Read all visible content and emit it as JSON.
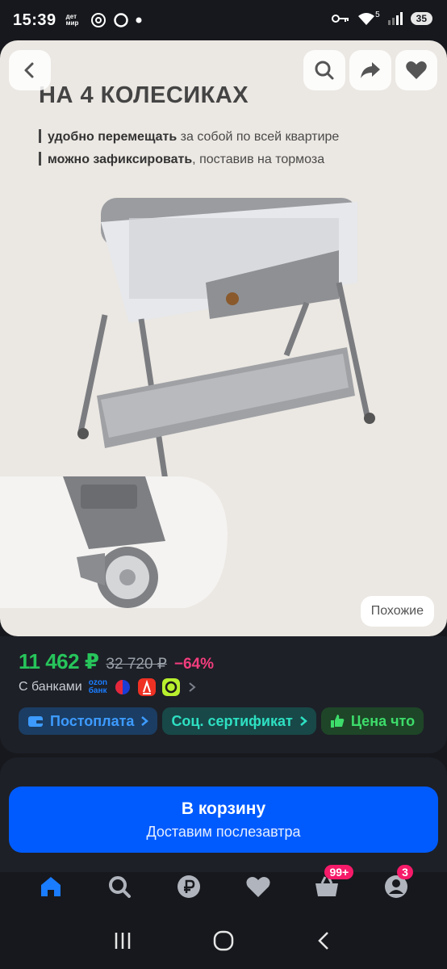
{
  "status_bar": {
    "time": "15:39",
    "brand_mini": "дет мир",
    "network_badge": "5",
    "battery": "35"
  },
  "gallery": {
    "heading": "НА 4 КОЛЕСИКАХ",
    "line1_bold": "удобно перемещать",
    "line1_rest": " за собой по всей квартире",
    "line2_bold": "можно зафиксировать",
    "line2_rest": ", поставив на тормоза",
    "similar_label": "Похожие",
    "icons": [
      "back-arrow",
      "search",
      "share",
      "heart"
    ]
  },
  "product": {
    "price": "11 462 ₽",
    "old_price": "32 720 ₽",
    "discount": "−64%",
    "banks_label": "С банками",
    "ozon_label_top": "ozon",
    "ozon_label_bottom": "банк"
  },
  "chips": [
    {
      "label": "Постоплата",
      "color": "#3d9bff"
    },
    {
      "label": "Соц. сертификат",
      "color": "#2ee0c2"
    },
    {
      "label": "Цена что",
      "color": "#3ddc6b"
    }
  ],
  "cart": {
    "title": "В корзину",
    "subtitle": "Доставим послезавтра"
  },
  "tabbar": {
    "cart_badge": "99+",
    "profile_badge": "3"
  },
  "colors": {
    "accent": "#005bff",
    "price": "#27c45b",
    "discount": "#f23d7d",
    "badge": "#f61a69"
  }
}
